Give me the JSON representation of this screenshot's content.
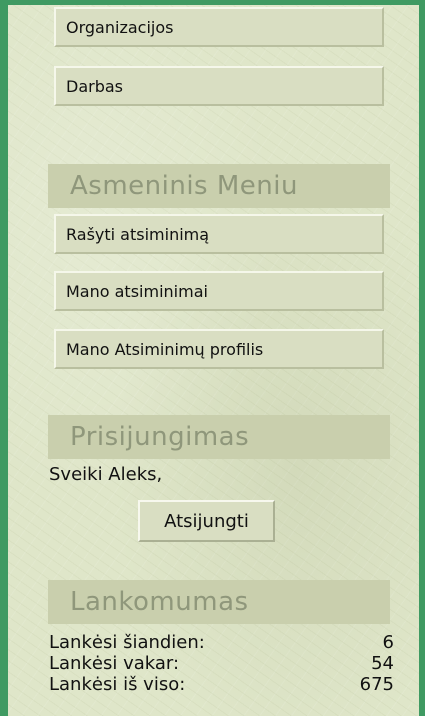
{
  "menu": {
    "items": [
      {
        "label": "Organizacijos"
      },
      {
        "label": "Darbas"
      }
    ]
  },
  "personal_menu": {
    "heading": "Asmeninis Meniu",
    "items": [
      {
        "label": "Rašyti atsiminimą"
      },
      {
        "label": "Mano atsiminimai"
      },
      {
        "label": "Mano Atsiminimų profilis"
      }
    ]
  },
  "login": {
    "heading": "Prisijungimas",
    "greeting": "Sveiki Aleks,",
    "logout_label": "Atsijungti"
  },
  "attendance": {
    "heading": "Lankomumas",
    "rows": [
      {
        "label": "Lankėsi šiandien:",
        "value": "6"
      },
      {
        "label": "Lankėsi vakar:",
        "value": "54"
      },
      {
        "label": "Lankėsi iš viso:",
        "value": "675"
      }
    ]
  },
  "colors": {
    "frame_border": "#3f9a62",
    "panel_background": "#dfe6c9",
    "heading_background": "#c9cfad",
    "heading_text": "#8f977b",
    "button_background": "#d9dec2"
  }
}
